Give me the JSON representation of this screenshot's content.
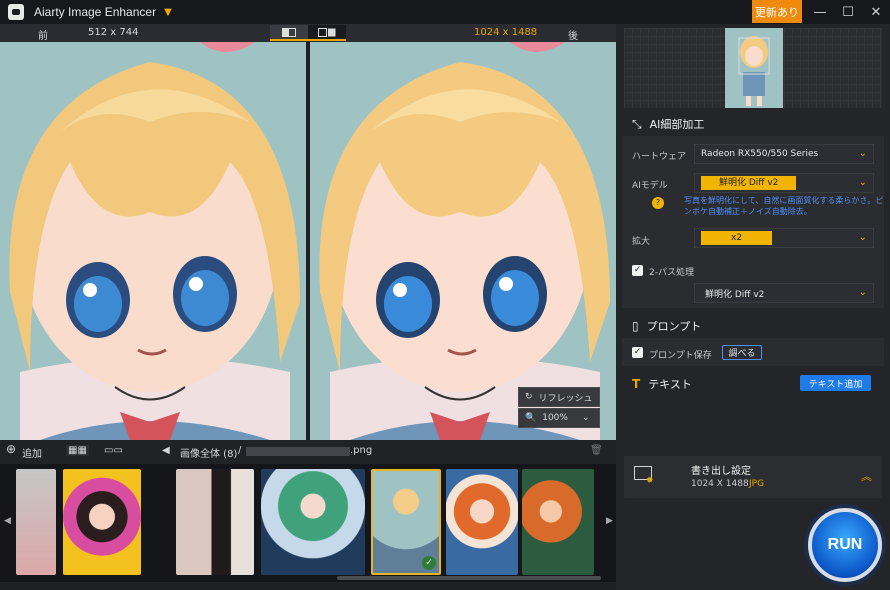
{
  "app": {
    "title": "Aiarty Image Enhancer",
    "update_label": "更新あり",
    "colors": {
      "accent": "#f0a800",
      "update": "#f08a0c",
      "link": "#4f8ff7",
      "run": "#1f7be8"
    }
  },
  "compare": {
    "before_label": "前",
    "before_size": "512 x 744",
    "after_size": "1024 x 1488",
    "after_label": "後"
  },
  "overlay": {
    "refresh_label": "リフレッシュ",
    "zoom_value": "100%"
  },
  "gallery_toolbar": {
    "add_label": "追加",
    "breadcrumb": "画像全体 (8)",
    "separator": "/",
    "filename_suffix": ".png"
  },
  "right_panel": {
    "ai_detail": {
      "title": "AI細部加工",
      "hardware_label": "ハートウェア",
      "hardware_value": "Radeon RX550/550 Series",
      "model_label": "AIモデル",
      "model_value": "鮮明化 Diff v2",
      "model_hint": "写真を鮮明化にして、自然に画面質化する柔らかさ。ピンボケ自動補正＋ノイズ自動除去。",
      "scale_label": "拡大",
      "scale_value": "x2",
      "twopass_label": "2-パス処理",
      "twopass_checked": true,
      "twopass_value": "鮮明化 Diff v2"
    },
    "prompt": {
      "title": "プロンプト",
      "save_label": "プロンプト保存",
      "save_checked": true,
      "check_label": "調べる"
    },
    "text": {
      "title": "テキスト",
      "add_label": "テキスト追加"
    },
    "export": {
      "title": "書き出し設定",
      "size": "1024 X 1488",
      "format": "JPG"
    },
    "run_label": "RUN"
  }
}
